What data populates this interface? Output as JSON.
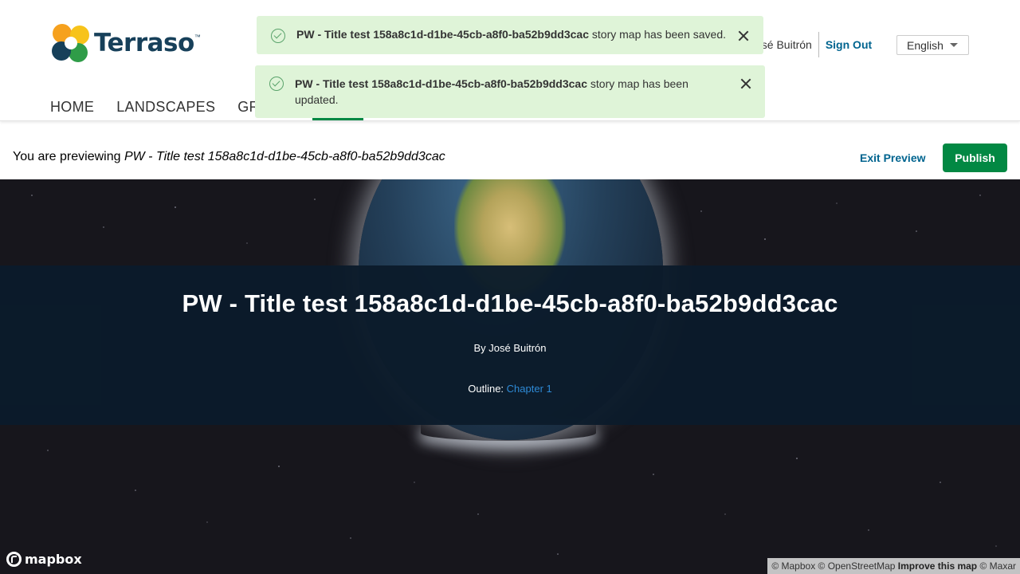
{
  "header": {
    "logo_text": "Terraso",
    "logo_tm": "™",
    "user_name": "osé Buitrón",
    "sign_out": "Sign Out",
    "language": "English",
    "nav": [
      "HOME",
      "LANDSCAPES",
      "GRO"
    ]
  },
  "toasts": [
    {
      "title": "PW - Title test 158a8c1d-d1be-45cb-a8f0-ba52b9dd3cac",
      "message": " story map has been saved."
    },
    {
      "title": "PW - Title test 158a8c1d-d1be-45cb-a8f0-ba52b9dd3cac",
      "message": " story map has been updated."
    }
  ],
  "preview": {
    "prefix": "You are previewing ",
    "title": "PW - Title test 158a8c1d-d1be-45cb-a8f0-ba52b9dd3cac",
    "exit_label": "Exit Preview",
    "publish_label": "Publish"
  },
  "story": {
    "title": "PW - Title test 158a8c1d-d1be-45cb-a8f0-ba52b9dd3cac",
    "byline": "By José Buitrón",
    "outline_label": "Outline: ",
    "outline_link": "Chapter 1"
  },
  "map": {
    "logo": "mapbox",
    "attribution": {
      "mapbox": "© Mapbox",
      "osm": "© OpenStreetMap",
      "improve": "Improve this map",
      "maxar": "© Maxar"
    }
  },
  "colors": {
    "brand_green": "#028843",
    "link_blue": "#00648f",
    "toast_bg": "#dff4d8",
    "panel_bg": "#0b1b2b"
  }
}
